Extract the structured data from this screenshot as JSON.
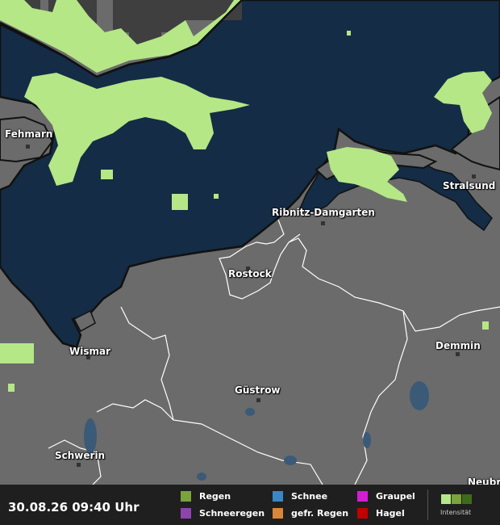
{
  "map": {
    "colors": {
      "land": "#6b6b6b",
      "water": "#142c45",
      "rain_light": "#b5e787",
      "dark_patch": "#3f3f3f",
      "coast": "#111111",
      "border": "#ffffff"
    },
    "cities": [
      {
        "name": "Fehmarn"
      },
      {
        "name": "Ribnitz-Damgarten"
      },
      {
        "name": "Stralsund"
      },
      {
        "name": "Rostock"
      },
      {
        "name": "Wismar"
      },
      {
        "name": "Demmin"
      },
      {
        "name": "Güstrow"
      },
      {
        "name": "Schwerin"
      },
      {
        "name": "Neubr"
      }
    ]
  },
  "footer": {
    "timestamp": "30.08.26 09:40 Uhr",
    "legend": [
      {
        "label": "Regen",
        "color": "#7aa33c"
      },
      {
        "label": "Schneeregen",
        "color": "#8e44ad"
      },
      {
        "label": "Schnee",
        "color": "#3b86c6"
      },
      {
        "label": "gefr. Regen",
        "color": "#d9863a"
      },
      {
        "label": "Graupel",
        "color": "#d41cd4"
      },
      {
        "label": "Hagel",
        "color": "#c20000"
      }
    ],
    "intensity_label": "Intensität",
    "intensity_colors": [
      "#b5e787",
      "#7aa33c",
      "#3e6b1a"
    ]
  }
}
